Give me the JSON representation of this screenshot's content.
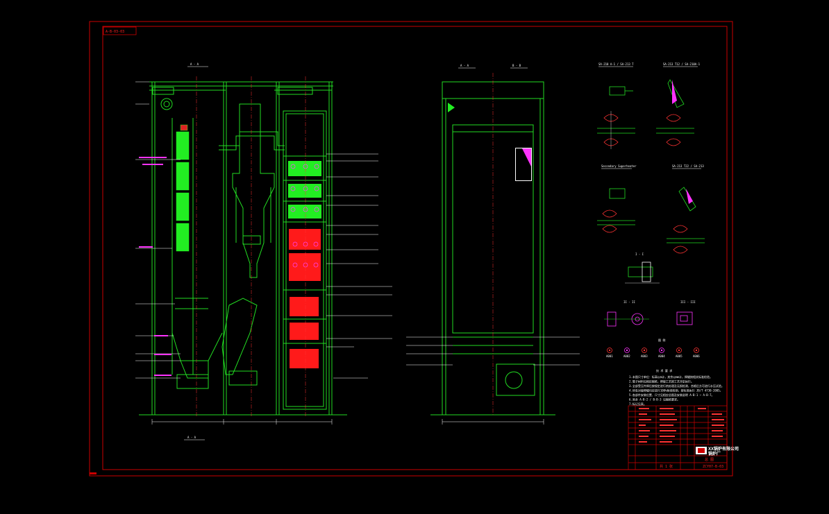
{
  "drawing": {
    "drawing_no": "A-B-03-03",
    "code": "ZCY07-B-03"
  },
  "views": {
    "front_label": "A - A",
    "side_a_label": "A - A",
    "side_b_label": "B - B",
    "bottom_label": "A - A"
  },
  "details": {
    "d1": "SA-210 A-1 / SA-213 T",
    "d2": "SA-213 T12 / SA-210A-1",
    "d3": "Secondary Superheater",
    "d4": "SA-213 T22 / SA-213",
    "d5": "I - I",
    "d6": "II - II",
    "d7": "III - III"
  },
  "legend": {
    "title": "图  例",
    "items": [
      "A001",
      "A002",
      "A003",
      "A004",
      "A005",
      "A006"
    ]
  },
  "notes": {
    "title": "技 术 要 求",
    "lines": [
      "1.本图尺寸单位：标高以m计，其余以mm计，焊缝按相关标准检验。",
      "2.管子材料见相应图纸，焊接工艺按工艺评定执行。",
      "3.全部受压件焊后按规定进行热处理及无损检测，合格后方可进行水压试验。",
      "4.所有对接焊缝均应进行100%射线检测，按标准执行 JB/T 4730-2005。",
      "5.各部件安装位置、尺寸见相应总图及安装说明 A-B-1 ~ A-B-7。",
      "6.其余 A-B-2 / B-B-3 见图纸要求。",
      "7.标记见表。"
    ]
  },
  "title_block": {
    "company": "XX锅炉有限公司",
    "company_sub": "锅炉厂",
    "drawing_name": "总 图",
    "code": "ZCY07-B-03",
    "sheet": "共 1 张"
  }
}
